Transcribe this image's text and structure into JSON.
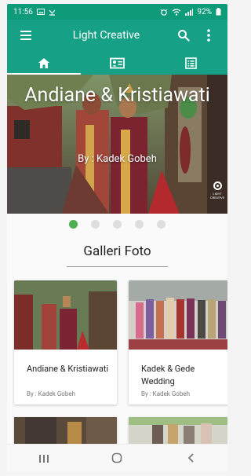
{
  "status": {
    "time": "11:56",
    "battery": "92%"
  },
  "appbar": {
    "title": "Light Creative"
  },
  "tabs": [
    {
      "name": "home",
      "icon": "home-icon"
    },
    {
      "name": "profile",
      "icon": "id-card-icon"
    },
    {
      "name": "list",
      "icon": "list-icon"
    }
  ],
  "hero": {
    "title": "Andiane & Kristiawati",
    "subtitle": "By : Kadek Gobeh",
    "logo_text": "LIGHT CREATIVE"
  },
  "carousel": {
    "count": 5,
    "active_index": 0
  },
  "gallery": {
    "title": "Galleri Foto",
    "cards": [
      {
        "title": "Andiane & Kristiawati",
        "author": "By : Kadek Gobeh"
      },
      {
        "title": "Kadek & Gede Wedding",
        "author": "By : Kadek Gobeh"
      }
    ]
  },
  "colors": {
    "primary": "#16a085",
    "status_bar": "#0e9b7a",
    "active_dot": "#4caf50"
  }
}
